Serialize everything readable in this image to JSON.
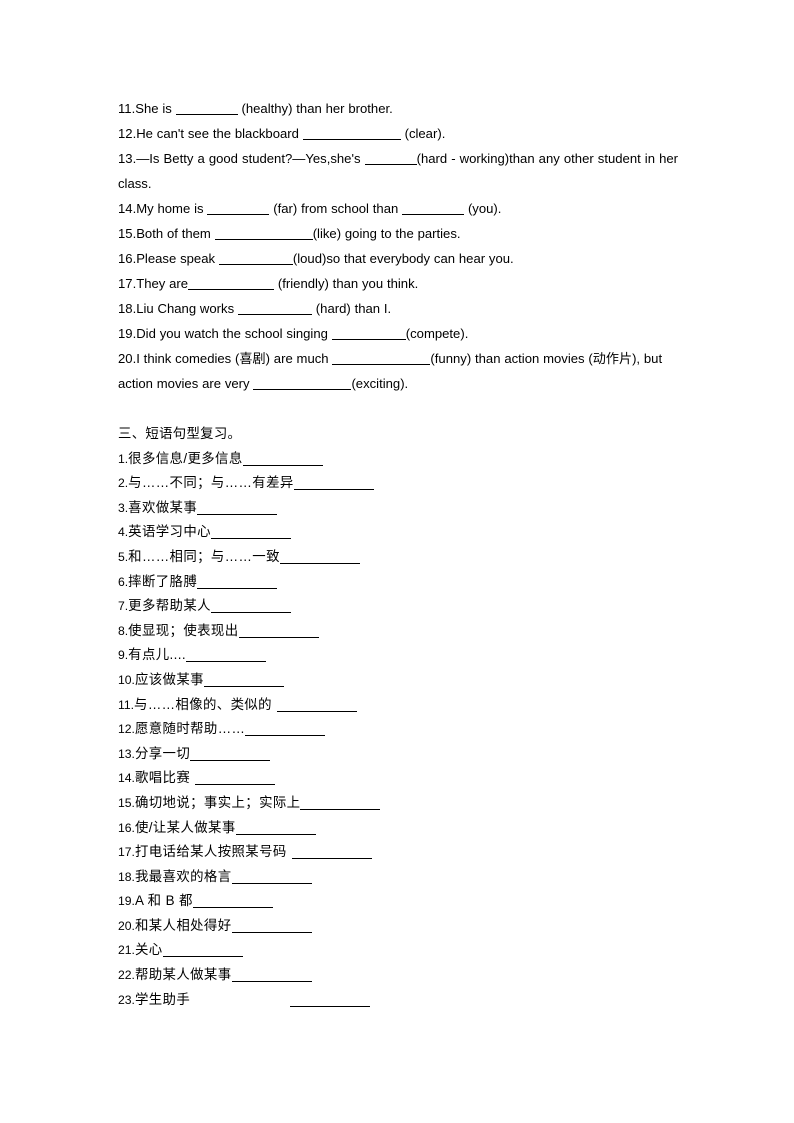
{
  "document": {
    "type": "english-grammar-worksheet",
    "background_color": "#ffffff",
    "text_color": "#000000"
  },
  "english_exercises": {
    "items": [
      {
        "number": "11.",
        "segments": [
          {
            "t": "text",
            "v": "She is "
          },
          {
            "t": "blank",
            "w": "b-m"
          },
          {
            "t": "text",
            "v": " (healthy) than her brother."
          }
        ]
      },
      {
        "number": "12.",
        "segments": [
          {
            "t": "text",
            "v": "He can't see the blackboard "
          },
          {
            "t": "blank",
            "w": "b-xxl"
          },
          {
            "t": "text",
            "v": " (clear)."
          }
        ]
      },
      {
        "number": "13.",
        "justified": true,
        "segments": [
          {
            "t": "text",
            "v": "—Is Betty a good student?—Yes,she's "
          },
          {
            "t": "blank",
            "w": "b-s"
          },
          {
            "t": "text",
            "v": "(hard - working)than any other student in her class."
          }
        ]
      },
      {
        "number": "14.",
        "segments": [
          {
            "t": "text",
            "v": "My home is "
          },
          {
            "t": "blank",
            "w": "b-m"
          },
          {
            "t": "text",
            "v": " (far) from school than "
          },
          {
            "t": "blank",
            "w": "b-m"
          },
          {
            "t": "text",
            "v": " (you)."
          }
        ]
      },
      {
        "number": "15.",
        "segments": [
          {
            "t": "text",
            "v": "Both of them "
          },
          {
            "t": "blank",
            "w": "b-xxl"
          },
          {
            "t": "text",
            "v": "(like) going to the parties."
          }
        ]
      },
      {
        "number": "16.",
        "segments": [
          {
            "t": "text",
            "v": "Please speak "
          },
          {
            "t": "blank",
            "w": "b-l"
          },
          {
            "t": "text",
            "v": "(loud)so that everybody can hear you."
          }
        ]
      },
      {
        "number": "17.",
        "segments": [
          {
            "t": "text",
            "v": "They are"
          },
          {
            "t": "blank",
            "w": "b-xl"
          },
          {
            "t": "text",
            "v": " (friendly) than you think."
          }
        ]
      },
      {
        "number": "18.",
        "segments": [
          {
            "t": "text",
            "v": "Liu Chang works "
          },
          {
            "t": "blank",
            "w": "b-l"
          },
          {
            "t": "text",
            "v": " (hard) than I."
          }
        ]
      },
      {
        "number": "19.",
        "segments": [
          {
            "t": "text",
            "v": "Did you watch the school singing "
          },
          {
            "t": "blank",
            "w": "b-l"
          },
          {
            "t": "text",
            "v": "(compete)."
          }
        ]
      },
      {
        "number": "20.",
        "segments": [
          {
            "t": "text",
            "v": "I think comedies (喜剧) are much "
          },
          {
            "t": "blank",
            "w": "b-xxl"
          },
          {
            "t": "text",
            "v": "(funny) than action movies (动作片), but action movies are very "
          },
          {
            "t": "blank",
            "w": "b-xxl"
          },
          {
            "t": "text",
            "v": "(exciting)."
          }
        ]
      }
    ]
  },
  "chinese_section": {
    "heading": "三、短语句型复习。",
    "items": [
      {
        "number": "1.",
        "text": "很多信息/更多信息",
        "gap": "none"
      },
      {
        "number": "2.",
        "text": "与……不同；与……有差异",
        "gap": "none"
      },
      {
        "number": "3.",
        "text": "喜欢做某事",
        "gap": "none"
      },
      {
        "number": "4.",
        "text": "英语学习中心",
        "gap": "none"
      },
      {
        "number": "5.",
        "text": "和……相同；与……一致",
        "gap": "none"
      },
      {
        "number": "6.",
        "text": "摔断了胳膊",
        "gap": "none"
      },
      {
        "number": "7.",
        "text": "更多帮助某人",
        "gap": "none"
      },
      {
        "number": "8.",
        "text": "使显现；使表现出",
        "gap": "none"
      },
      {
        "number": "9.",
        "text": "有点儿....",
        "gap": "none"
      },
      {
        "number": "10.",
        "text": "应该做某事",
        "gap": "none"
      },
      {
        "number": "11.",
        "text": "与……相像的、类似的",
        "gap": "small"
      },
      {
        "number": "12.",
        "text": "愿意随时帮助……",
        "gap": "none"
      },
      {
        "number": "13.",
        "text": "分享一切",
        "gap": "none"
      },
      {
        "number": "14.",
        "text": "歌唱比赛",
        "gap": "small"
      },
      {
        "number": "15.",
        "text": "确切地说；事实上；实际上",
        "gap": "none"
      },
      {
        "number": "16.",
        "text": "使/让某人做某事",
        "gap": "none"
      },
      {
        "number": "17.",
        "text": "打电话给某人按照某号码",
        "gap": "small"
      },
      {
        "number": "18.",
        "text": "我最喜欢的格言",
        "gap": "none"
      },
      {
        "number": "19.",
        "text": "A 和 B 都",
        "gap": "none"
      },
      {
        "number": "20.",
        "text": "和某人相处得好",
        "gap": "none"
      },
      {
        "number": "21.",
        "text": "关心",
        "gap": "none"
      },
      {
        "number": "22.",
        "text": "帮助某人做某事",
        "gap": "none"
      },
      {
        "number": "23.",
        "text": "学生助手",
        "gap": "large"
      }
    ]
  }
}
